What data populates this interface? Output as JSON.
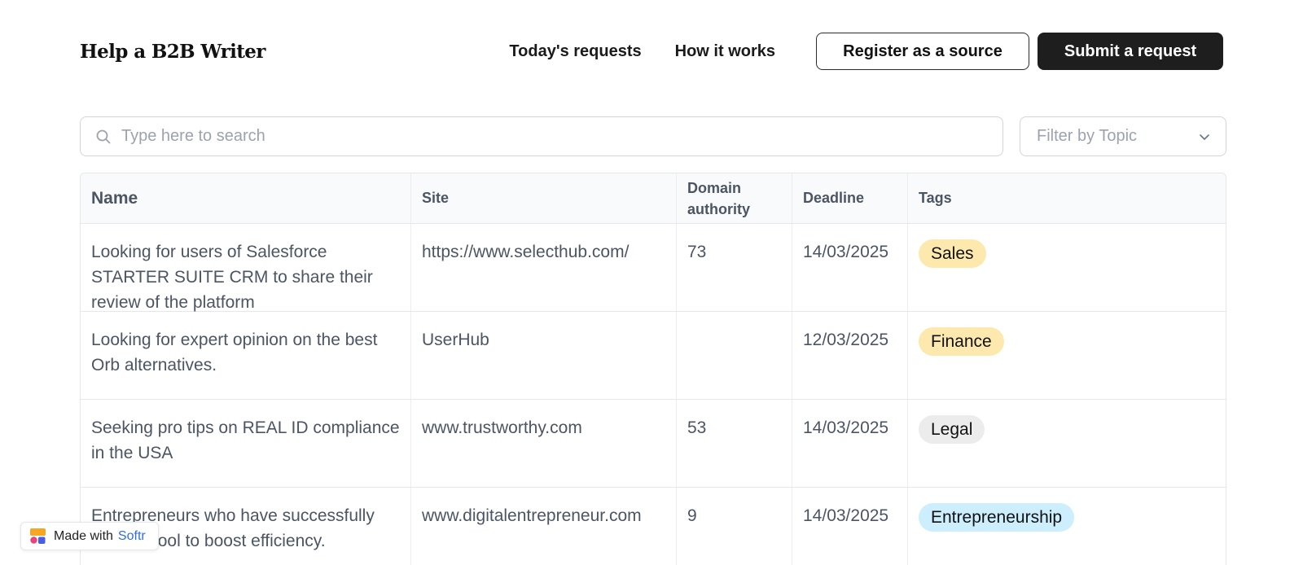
{
  "header": {
    "brand": "Help a B2B Writer",
    "nav": [
      "Today's requests",
      "How it works"
    ],
    "register_label": "Register as a source",
    "submit_label": "Submit a request"
  },
  "search": {
    "placeholder": "Type here to search",
    "value": ""
  },
  "filter": {
    "placeholder": "Filter by Topic"
  },
  "table": {
    "columns": [
      "Name",
      "Site",
      "Domain authority",
      "Deadline",
      "Tags"
    ],
    "rows": [
      {
        "name": "Looking for users of Salesforce STARTER SUITE CRM to share their review of the platform",
        "site": "https://www.selecthub.com/",
        "da": "73",
        "deadline": "14/03/2025",
        "tag": "Sales",
        "tag_color": "#fde9ad"
      },
      {
        "name": "Looking for expert opinion on the best Orb alternatives.",
        "site": "UserHub",
        "da": "",
        "deadline": "12/03/2025",
        "tag": "Finance",
        "tag_color": "#fde9ad"
      },
      {
        "name": "Seeking pro tips on REAL ID compliance in the USA",
        "site": "www.trustworthy.com",
        "da": "53",
        "deadline": "14/03/2025",
        "tag": "Legal",
        "tag_color": "#ececec"
      },
      {
        "name": "Entrepreneurs who have successfully used AI tool to boost efficiency.",
        "site": "www.digitalentrepreneur.com",
        "da": "9",
        "deadline": "14/03/2025",
        "tag": "Entrepreneurship",
        "tag_color": "#cdeefd"
      }
    ]
  },
  "badge": {
    "made_with": "Made with",
    "brand": "Softr"
  },
  "colors": {
    "primary_button": "#1e1e1e",
    "softr_link": "#2f6fd8"
  }
}
